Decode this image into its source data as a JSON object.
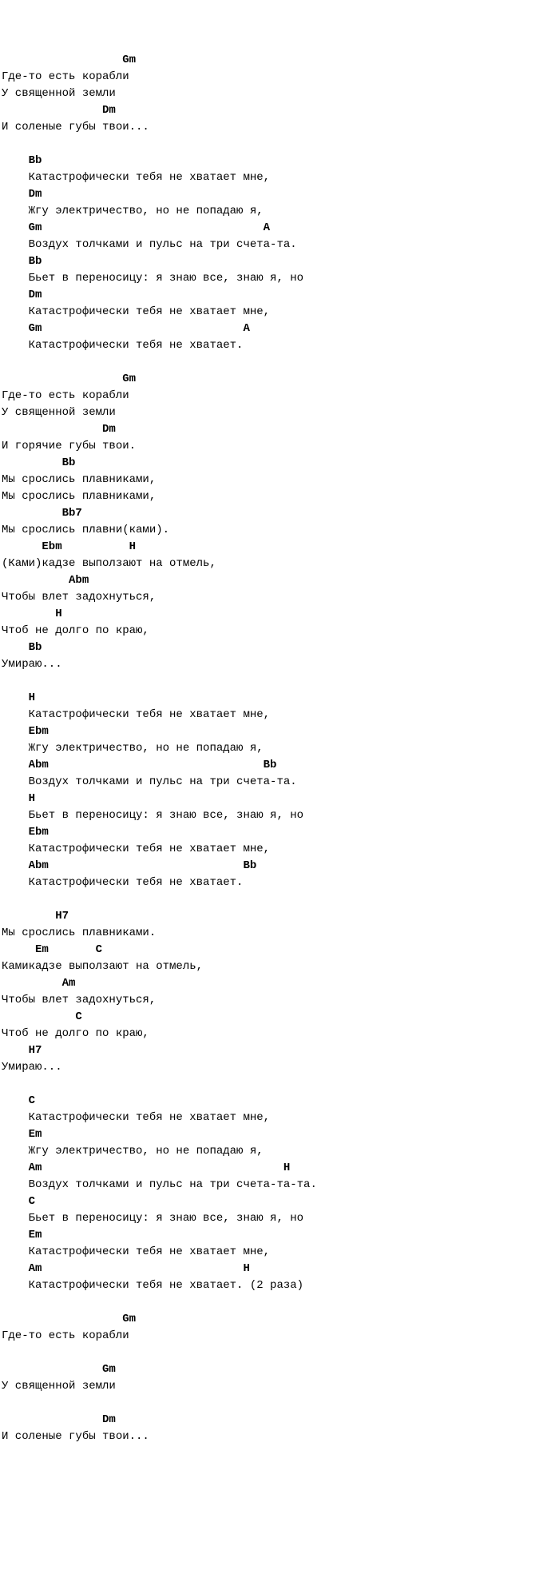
{
  "lines": [
    {
      "type": "chord",
      "text": "                  Gm"
    },
    {
      "type": "lyric",
      "text": "Где-то есть корабли"
    },
    {
      "type": "lyric",
      "text": "У священной земли"
    },
    {
      "type": "chord",
      "text": "               Dm"
    },
    {
      "type": "lyric",
      "text": "И соленые губы твои..."
    },
    {
      "type": "blank",
      "text": ""
    },
    {
      "type": "chord",
      "text": "    Bb"
    },
    {
      "type": "lyric",
      "text": "    Катастрофически тебя не хватает мне,"
    },
    {
      "type": "chord",
      "text": "    Dm"
    },
    {
      "type": "lyric",
      "text": "    Жгу электричество, но не попадаю я,"
    },
    {
      "type": "chord",
      "text": "    Gm                                 A"
    },
    {
      "type": "lyric",
      "text": "    Воздух толчками и пульс на три счета-та."
    },
    {
      "type": "chord",
      "text": "    Bb"
    },
    {
      "type": "lyric",
      "text": "    Бьет в переносицу: я знаю все, знаю я, но"
    },
    {
      "type": "chord",
      "text": "    Dm"
    },
    {
      "type": "lyric",
      "text": "    Катастрофически тебя не хватает мне,"
    },
    {
      "type": "chord",
      "text": "    Gm                              A"
    },
    {
      "type": "lyric",
      "text": "    Катастрофически тебя не хватает."
    },
    {
      "type": "blank",
      "text": ""
    },
    {
      "type": "chord",
      "text": "                  Gm"
    },
    {
      "type": "lyric",
      "text": "Где-то есть корабли"
    },
    {
      "type": "lyric",
      "text": "У священной земли"
    },
    {
      "type": "chord",
      "text": "               Dm"
    },
    {
      "type": "lyric",
      "text": "И горячие губы твои."
    },
    {
      "type": "chord",
      "text": "         Bb"
    },
    {
      "type": "lyric",
      "text": "Мы срослись плавниками,"
    },
    {
      "type": "lyric",
      "text": "Мы срослись плавниками,"
    },
    {
      "type": "chord",
      "text": "         Bb7"
    },
    {
      "type": "lyric",
      "text": "Мы срослись плавни(ками)."
    },
    {
      "type": "chord",
      "text": "      Ebm          H"
    },
    {
      "type": "lyric",
      "text": "(Ками)кадзе выползают на отмель,"
    },
    {
      "type": "chord",
      "text": "          Abm"
    },
    {
      "type": "lyric",
      "text": "Чтобы влет задохнуться,"
    },
    {
      "type": "chord",
      "text": "        H"
    },
    {
      "type": "lyric",
      "text": "Чтоб не долго по краю,"
    },
    {
      "type": "chord",
      "text": "    Bb"
    },
    {
      "type": "lyric",
      "text": "Умираю..."
    },
    {
      "type": "blank",
      "text": ""
    },
    {
      "type": "chord",
      "text": "    H"
    },
    {
      "type": "lyric",
      "text": "    Катастрофически тебя не хватает мне,"
    },
    {
      "type": "chord",
      "text": "    Ebm"
    },
    {
      "type": "lyric",
      "text": "    Жгу электричество, но не попадаю я,"
    },
    {
      "type": "chord",
      "text": "    Abm                                Bb"
    },
    {
      "type": "lyric",
      "text": "    Воздух толчками и пульс на три счета-та."
    },
    {
      "type": "chord",
      "text": "    H"
    },
    {
      "type": "lyric",
      "text": "    Бьет в переносицу: я знаю все, знаю я, но"
    },
    {
      "type": "chord",
      "text": "    Ebm"
    },
    {
      "type": "lyric",
      "text": "    Катастрофически тебя не хватает мне,"
    },
    {
      "type": "chord",
      "text": "    Abm                             Bb"
    },
    {
      "type": "lyric",
      "text": "    Катастрофически тебя не хватает."
    },
    {
      "type": "blank",
      "text": ""
    },
    {
      "type": "chord",
      "text": "        H7"
    },
    {
      "type": "lyric",
      "text": "Мы срослись плавниками."
    },
    {
      "type": "chord",
      "text": "     Em       C"
    },
    {
      "type": "lyric",
      "text": "Камикадзе выползают на отмель,"
    },
    {
      "type": "chord",
      "text": "         Am"
    },
    {
      "type": "lyric",
      "text": "Чтобы влет задохнуться,"
    },
    {
      "type": "chord",
      "text": "           C"
    },
    {
      "type": "lyric",
      "text": "Чтоб не долго по краю,"
    },
    {
      "type": "chord",
      "text": "    H7"
    },
    {
      "type": "lyric",
      "text": "Умираю..."
    },
    {
      "type": "blank",
      "text": ""
    },
    {
      "type": "chord",
      "text": "    C"
    },
    {
      "type": "lyric",
      "text": "    Катастрофически тебя не хватает мне,"
    },
    {
      "type": "chord",
      "text": "    Em"
    },
    {
      "type": "lyric",
      "text": "    Жгу электричество, но не попадаю я,"
    },
    {
      "type": "chord",
      "text": "    Am                                    H"
    },
    {
      "type": "lyric",
      "text": "    Воздух толчками и пульс на три счета-та-та."
    },
    {
      "type": "chord",
      "text": "    C"
    },
    {
      "type": "lyric",
      "text": "    Бьет в переносицу: я знаю все, знаю я, но"
    },
    {
      "type": "chord",
      "text": "    Em"
    },
    {
      "type": "lyric",
      "text": "    Катастрофически тебя не хватает мне,"
    },
    {
      "type": "chord",
      "text": "    Am                              H"
    },
    {
      "type": "lyric",
      "text": "    Катастрофически тебя не хватает. (2 раза)"
    },
    {
      "type": "blank",
      "text": ""
    },
    {
      "type": "chord",
      "text": "                  Gm"
    },
    {
      "type": "lyric",
      "text": "Где-то есть корабли"
    },
    {
      "type": "blank",
      "text": ""
    },
    {
      "type": "chord",
      "text": "               Gm"
    },
    {
      "type": "lyric",
      "text": "У священной земли"
    },
    {
      "type": "blank",
      "text": ""
    },
    {
      "type": "chord",
      "text": "               Dm"
    },
    {
      "type": "lyric",
      "text": "И соленые губы твои..."
    }
  ]
}
